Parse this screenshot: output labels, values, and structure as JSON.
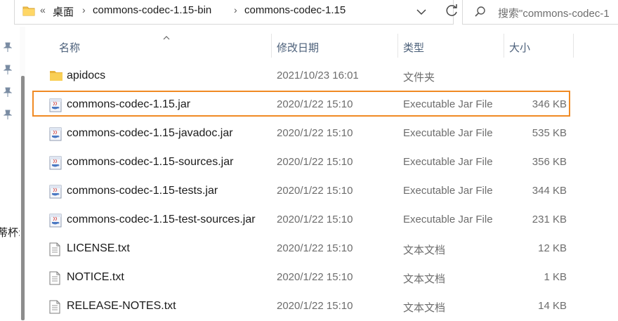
{
  "address_bar": {
    "overflow": "«",
    "crumbs": [
      "桌面",
      "commons-codec-1.15-bin",
      "commons-codec-1.15"
    ]
  },
  "search": {
    "placeholder": "搜索\"commons-codec-1"
  },
  "left_clip_text": "蒂杯:",
  "columns": {
    "name": "名称",
    "date": "修改日期",
    "type": "类型",
    "size": "大小"
  },
  "files": [
    {
      "icon": "folder-icon",
      "name": "apidocs",
      "date": "2021/10/23 16:01",
      "type": "文件夹",
      "size": ""
    },
    {
      "icon": "jar-icon",
      "name": "commons-codec-1.15.jar",
      "date": "2020/1/22 15:10",
      "type": "Executable Jar File",
      "size": "346 KB"
    },
    {
      "icon": "jar-icon",
      "name": "commons-codec-1.15-javadoc.jar",
      "date": "2020/1/22 15:10",
      "type": "Executable Jar File",
      "size": "535 KB"
    },
    {
      "icon": "jar-icon",
      "name": "commons-codec-1.15-sources.jar",
      "date": "2020/1/22 15:10",
      "type": "Executable Jar File",
      "size": "356 KB"
    },
    {
      "icon": "jar-icon",
      "name": "commons-codec-1.15-tests.jar",
      "date": "2020/1/22 15:10",
      "type": "Executable Jar File",
      "size": "344 KB"
    },
    {
      "icon": "jar-icon",
      "name": "commons-codec-1.15-test-sources.jar",
      "date": "2020/1/22 15:10",
      "type": "Executable Jar File",
      "size": "231 KB"
    },
    {
      "icon": "text-file-icon",
      "name": "LICENSE.txt",
      "date": "2020/1/22 15:10",
      "type": "文本文档",
      "size": "12 KB"
    },
    {
      "icon": "text-file-icon",
      "name": "NOTICE.txt",
      "date": "2020/1/22 15:10",
      "type": "文本文档",
      "size": "1 KB"
    },
    {
      "icon": "text-file-icon",
      "name": "RELEASE-NOTES.txt",
      "date": "2020/1/22 15:10",
      "type": "文本文档",
      "size": "14 KB"
    }
  ],
  "highlighted_file": "commons-codec-1.15.jar",
  "colors": {
    "highlight": "#f08a24",
    "folder": "#f4c34e",
    "header_text": "#4c607a"
  }
}
